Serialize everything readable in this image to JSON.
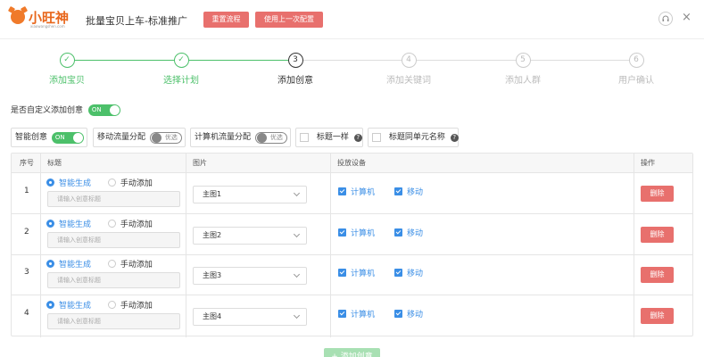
{
  "header": {
    "logo_text": "小旺神",
    "logo_sub": "xiaowangshen.com",
    "title": "批量宝贝上车-标准推广",
    "reset_label": "重置流程",
    "last_config_label": "使用上一次配置",
    "close_glyph": "×"
  },
  "steps": [
    {
      "num": "✓",
      "label": "添加宝贝",
      "state": "done"
    },
    {
      "num": "✓",
      "label": "选择计划",
      "state": "done"
    },
    {
      "num": "3",
      "label": "添加创意",
      "state": "current"
    },
    {
      "num": "4",
      "label": "添加关键词",
      "state": "pending"
    },
    {
      "num": "5",
      "label": "添加人群",
      "state": "pending"
    },
    {
      "num": "6",
      "label": "用户确认",
      "state": "pending"
    }
  ],
  "custom_creative": {
    "label": "是否自定义添加创意",
    "toggle": "ON"
  },
  "options": {
    "smart_creative": {
      "label": "智能创意",
      "toggle": "ON"
    },
    "mobile_flow": {
      "label": "移动流量分配",
      "toggle": "优选"
    },
    "pc_flow": {
      "label": "计算机流量分配",
      "toggle": "优选"
    },
    "same_title": {
      "label": "标题一样",
      "help": "?"
    },
    "title_unit_name": {
      "label": "标题同单元名称",
      "help": "?"
    }
  },
  "table": {
    "headers": {
      "seq": "序号",
      "title": "标题",
      "image": "图片",
      "device": "投放设备",
      "action": "操作"
    },
    "rows": [
      {
        "seq": "1",
        "radio_smart": "智能生成",
        "radio_manual": "手动添加",
        "title_placeholder": "请输入创意标题",
        "image": "主图1",
        "pc": "计算机",
        "mobile": "移动",
        "delete": "删除"
      },
      {
        "seq": "2",
        "radio_smart": "智能生成",
        "radio_manual": "手动添加",
        "title_placeholder": "请输入创意标题",
        "image": "主图2",
        "pc": "计算机",
        "mobile": "移动",
        "delete": "删除"
      },
      {
        "seq": "3",
        "radio_smart": "智能生成",
        "radio_manual": "手动添加",
        "title_placeholder": "请输入创意标题",
        "image": "主图3",
        "pc": "计算机",
        "mobile": "移动",
        "delete": "删除"
      },
      {
        "seq": "4",
        "radio_smart": "智能生成",
        "radio_manual": "手动添加",
        "title_placeholder": "请输入创意标题",
        "image": "主图4",
        "pc": "计算机",
        "mobile": "移动",
        "delete": "删除"
      }
    ]
  },
  "footer": {
    "add_creative_label": "+ 添加创意"
  },
  "colors": {
    "accent_green": "#4cc06a",
    "accent_blue": "#3a8ee6",
    "danger_red": "#e8706d",
    "brand_orange": "#e8671c"
  }
}
